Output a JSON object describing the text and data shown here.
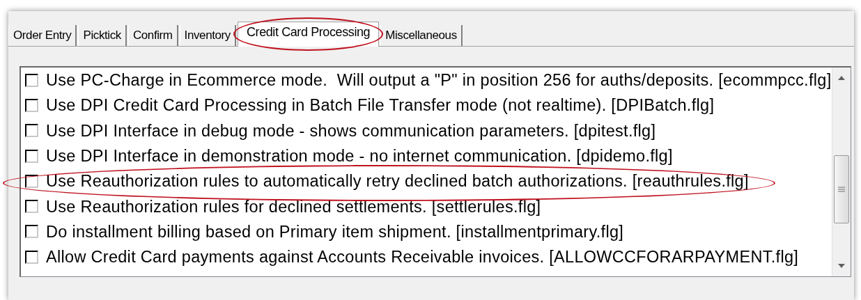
{
  "tabs": [
    {
      "label": "Order Entry",
      "selected": false,
      "highlighted": false
    },
    {
      "label": "Picktick",
      "selected": false,
      "highlighted": false
    },
    {
      "label": "Confirm",
      "selected": false,
      "highlighted": false
    },
    {
      "label": "Inventory",
      "selected": false,
      "highlighted": false
    },
    {
      "label": "Credit Card Processing",
      "selected": true,
      "highlighted": true
    },
    {
      "label": "Miscellaneous",
      "selected": false,
      "highlighted": false
    }
  ],
  "options": [
    {
      "label": "Use PC-Charge in Ecommerce mode.  Will output a \"P\" in position 256 for auths/deposits. [ecommpcc.flg]",
      "checked": false,
      "highlighted": false
    },
    {
      "label": "Use DPI Credit Card Processing in Batch File Transfer mode (not realtime). [DPIBatch.flg]",
      "checked": false,
      "highlighted": false
    },
    {
      "label": "Use DPI Interface in debug mode - shows communication parameters. [dpitest.flg]",
      "checked": false,
      "highlighted": false
    },
    {
      "label": "Use DPI Interface in demonstration mode - no internet communication. [dpidemo.flg]",
      "checked": false,
      "highlighted": false
    },
    {
      "label": "Use Reauthorization rules to automatically retry declined batch authorizations. [reauthrules.flg]",
      "checked": false,
      "highlighted": true
    },
    {
      "label": "Use Reauthorization rules for declined settlements. [settlerules.flg]",
      "checked": false,
      "highlighted": false
    },
    {
      "label": "Do installment billing based on Primary item shipment. [installmentprimary.flg]",
      "checked": false,
      "highlighted": false
    },
    {
      "label": "Allow Credit Card payments against Accounts Receivable invoices. [ALLOWCCFORARPAYMENT.flg]",
      "checked": false,
      "highlighted": false
    }
  ]
}
